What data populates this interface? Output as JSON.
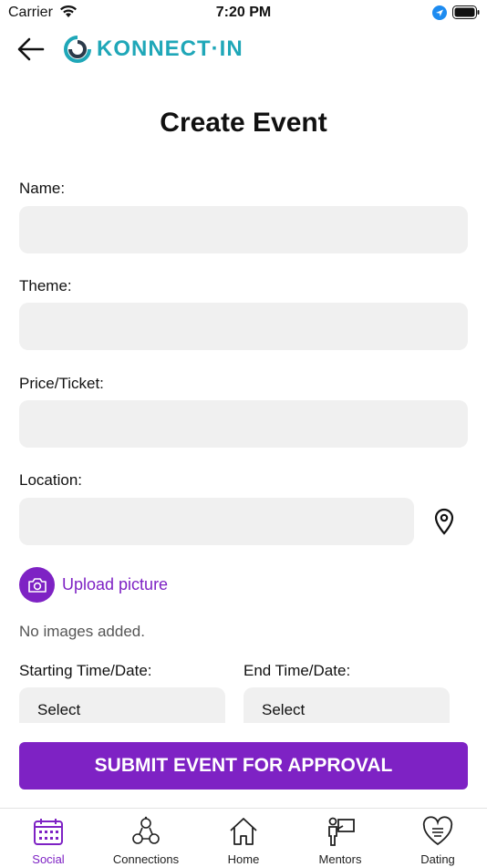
{
  "status_bar": {
    "carrier": "Carrier",
    "time": "7:20 PM"
  },
  "header": {
    "logo_text": "KONNECT·IN"
  },
  "page": {
    "title": "Create Event"
  },
  "form": {
    "name_label": "Name:",
    "name_value": "",
    "theme_label": "Theme:",
    "theme_value": "",
    "price_label": "Price/Ticket:",
    "price_value": "",
    "location_label": "Location:",
    "location_value": "",
    "upload_label": "Upload picture",
    "no_images": "No images added.",
    "start_label": "Starting Time/Date:",
    "start_value": "Select",
    "end_label": "End Time/Date:",
    "end_value": "Select",
    "submit_label": "SUBMIT EVENT FOR APPROVAL"
  },
  "tabs": [
    {
      "label": "Social",
      "icon": "calendar-icon",
      "active": true
    },
    {
      "label": "Connections",
      "icon": "connections-icon",
      "active": false
    },
    {
      "label": "Home",
      "icon": "home-icon",
      "active": false
    },
    {
      "label": "Mentors",
      "icon": "mentor-icon",
      "active": false
    },
    {
      "label": "Dating",
      "icon": "heart-icon",
      "active": false
    }
  ],
  "colors": {
    "accent": "#7e22c4",
    "logo": "#1fa7b8",
    "field_bg": "#f0f0f0"
  }
}
